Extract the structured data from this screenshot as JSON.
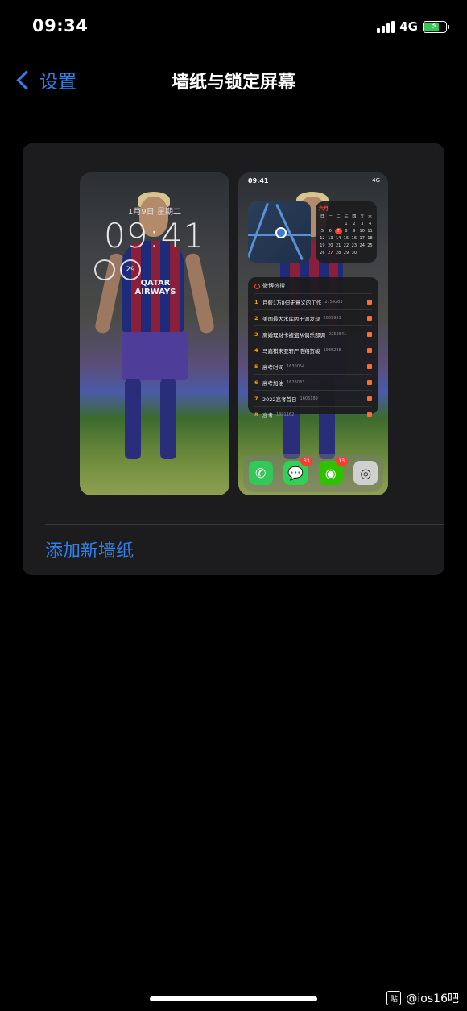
{
  "status_bar": {
    "time": "09:34",
    "network": "4G",
    "battery_charging": true,
    "battery_color": "#34c759",
    "icons": [
      "signal-icon",
      "battery-icon"
    ]
  },
  "nav": {
    "back_label": "设置",
    "title": "墙纸与锁定屏幕"
  },
  "card": {
    "add_label": "添加新墙纸"
  },
  "lock_preview": {
    "date": "1月9日 星期二",
    "time": "09:41",
    "sponsor": "QATAR AIRWAYS",
    "ring_value": "29"
  },
  "home_preview": {
    "time": "09:41",
    "network": "4G",
    "calendar_month": "六月",
    "calendar_days": [
      "日",
      "一",
      "二",
      "三",
      "四",
      "五",
      "六",
      "",
      "",
      "",
      "1",
      "2",
      "3",
      "4",
      "5",
      "6",
      "7",
      "8",
      "9",
      "10",
      "11",
      "12",
      "13",
      "14",
      "15",
      "16",
      "17",
      "18",
      "19",
      "20",
      "21",
      "22",
      "23",
      "24",
      "25",
      "26",
      "27",
      "28",
      "29",
      "30"
    ],
    "hot_title": "微博热搜",
    "hot_items": [
      {
        "rank": "1",
        "text": "月薪1万8但无意义的工作",
        "num": "2754283"
      },
      {
        "rank": "2",
        "text": "美国最大水库因干涸发现",
        "num": "2689931"
      },
      {
        "rank": "3",
        "text": "离婚理财卡被盗从俱乐部调",
        "num": "2258841"
      },
      {
        "rank": "4",
        "text": "马嘉祺宋亚轩严浩翔贺峻",
        "num": "1935288"
      },
      {
        "rank": "5",
        "text": "高考时间",
        "num": "1630054"
      },
      {
        "rank": "6",
        "text": "高考加油",
        "num": "1628033"
      },
      {
        "rank": "7",
        "text": "2022高考首日",
        "num": "1606189"
      },
      {
        "rank": "8",
        "text": "高考",
        "num": "1391162"
      }
    ],
    "dock_badges": {
      "messages": "33",
      "wechat": "13"
    }
  },
  "watermark": {
    "text": "@ios16吧",
    "logo": "贴"
  }
}
